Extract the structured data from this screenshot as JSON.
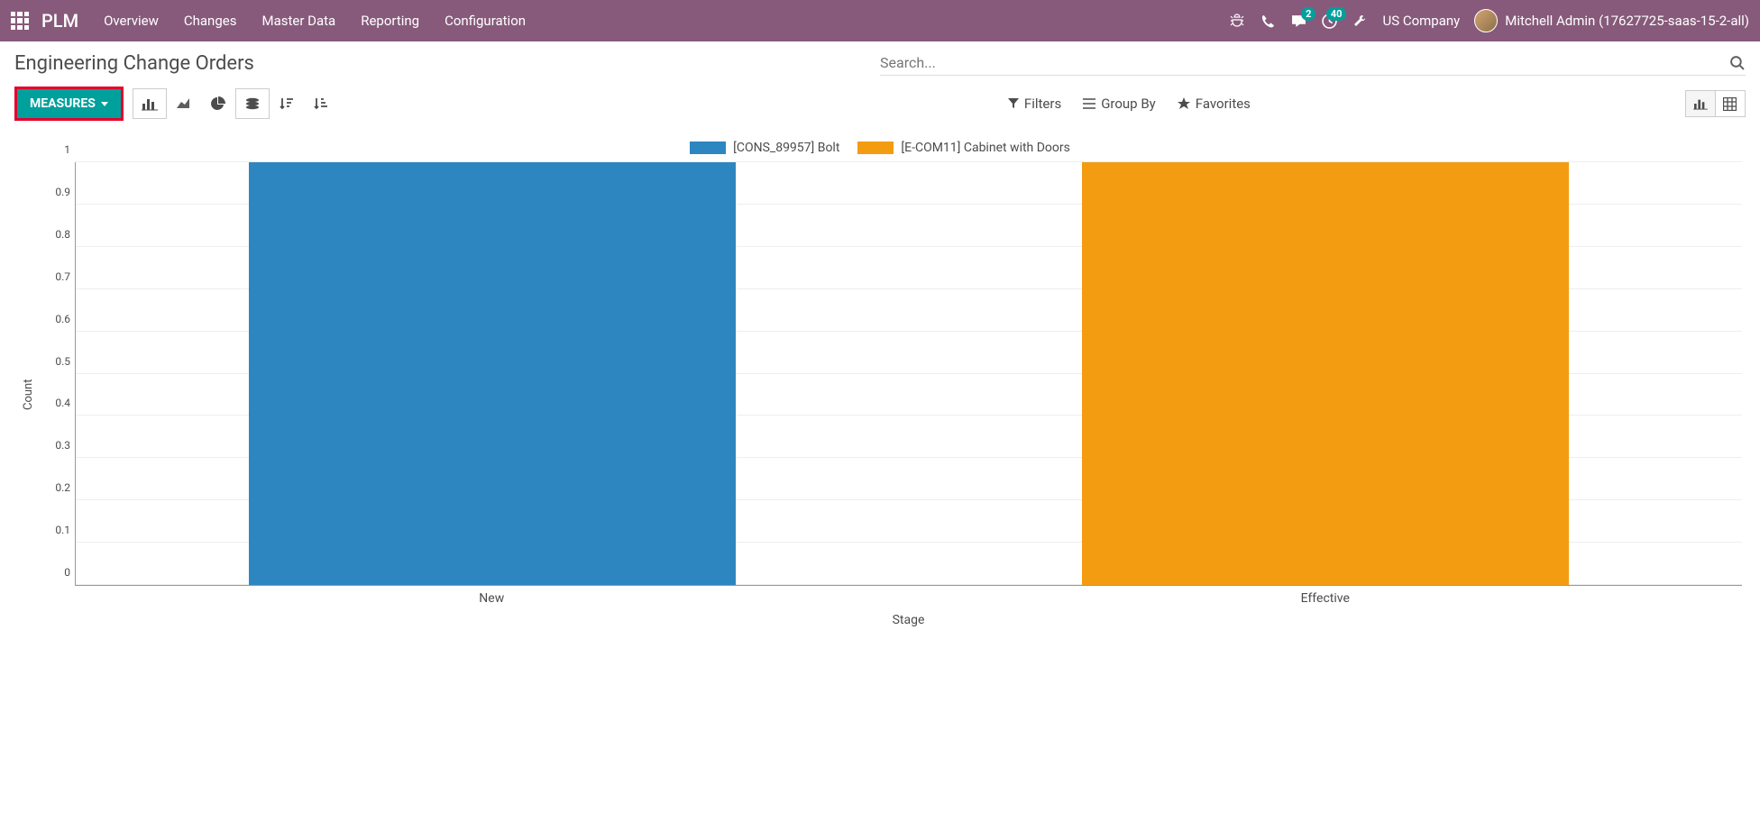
{
  "navbar": {
    "brand": "PLM",
    "menu": [
      "Overview",
      "Changes",
      "Master Data",
      "Reporting",
      "Configuration"
    ],
    "messages_badge": "2",
    "activities_badge": "40",
    "company": "US Company",
    "user": "Mitchell Admin (17627725-saas-15-2-all)"
  },
  "breadcrumb": "Engineering Change Orders",
  "search": {
    "placeholder": "Search..."
  },
  "toolbar": {
    "measures_label": "MEASURES",
    "filters": "Filters",
    "groupby": "Group By",
    "favorites": "Favorites"
  },
  "chart_data": {
    "type": "bar",
    "title": "",
    "xlabel": "Stage",
    "ylabel": "Count",
    "ylim": [
      0,
      1
    ],
    "yticks": [
      0,
      0.1,
      0.2,
      0.3,
      0.4,
      0.5,
      0.6,
      0.7,
      0.8,
      0.9,
      1
    ],
    "categories": [
      "New",
      "Effective"
    ],
    "series": [
      {
        "name": "[CONS_89957] Bolt",
        "color": "#2E86C1",
        "values": [
          1,
          0
        ]
      },
      {
        "name": "[E-COM11] Cabinet with Doors",
        "color": "#F39C12",
        "values": [
          0,
          1
        ]
      }
    ]
  }
}
